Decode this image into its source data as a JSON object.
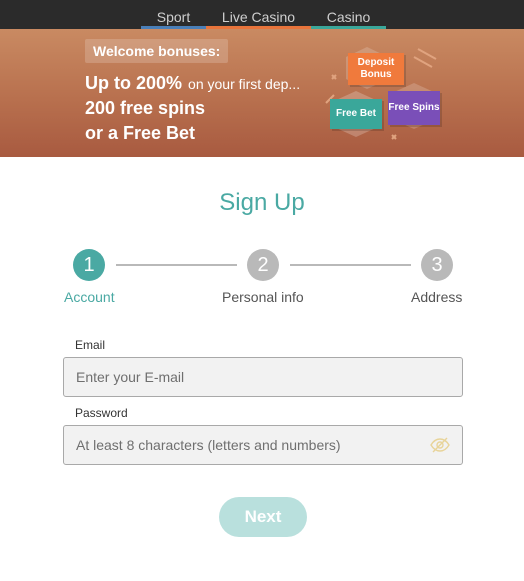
{
  "nav": {
    "tabs": [
      {
        "label": "Sport"
      },
      {
        "label": "Live Casino"
      },
      {
        "label": "Casino"
      }
    ]
  },
  "banner": {
    "badge": "Welcome bonuses:",
    "headline_big": "Up to 200%",
    "headline_small": "on your first dep...",
    "line2": "200 free spins",
    "line3": "or a Free Bet",
    "chips": {
      "deposit": "Deposit Bonus",
      "free_bet": "Free Bet",
      "free_spins": "Free Spins"
    }
  },
  "title": "Sign Up",
  "stepper": {
    "steps": [
      {
        "number": "1",
        "label": "Account",
        "active": true
      },
      {
        "number": "2",
        "label": "Personal info",
        "active": false
      },
      {
        "number": "3",
        "label": "Address",
        "active": false
      }
    ]
  },
  "form": {
    "email_label": "Email",
    "email_placeholder": "Enter your E-mail",
    "email_value": "",
    "password_label": "Password",
    "password_placeholder": "At least 8 characters (letters and numbers)",
    "password_value": ""
  },
  "next_label": "Next",
  "colors": {
    "accent": "#4aa9a3",
    "inactive_step": "#b9b9b9",
    "nav_bg": "#2b2b2b",
    "sport_underline": "#4a7fb8",
    "live_underline": "#e8743b",
    "casino_underline": "#3aa79a"
  },
  "icons": {
    "password_toggle": "eye-off-icon"
  }
}
